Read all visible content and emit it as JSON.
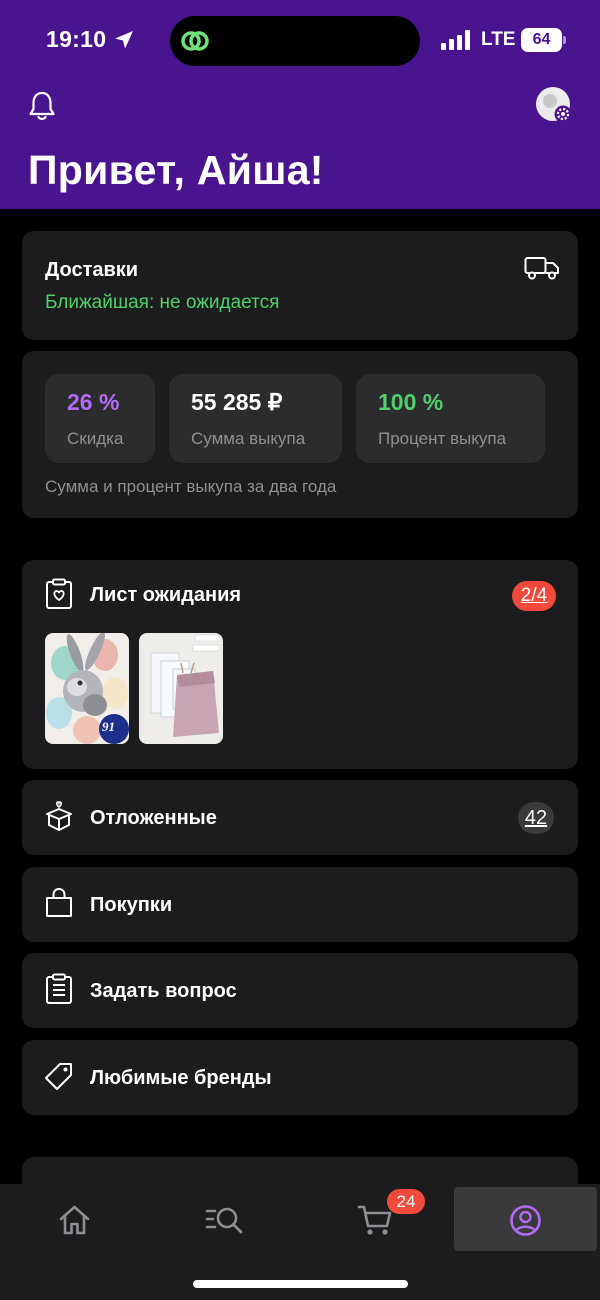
{
  "status_bar": {
    "time": "19:10",
    "network": "LTE",
    "battery": "64"
  },
  "header": {
    "greeting": "Привет, Айша!"
  },
  "delivery": {
    "title": "Доставки",
    "subtitle": "Ближайшая: не ожидается"
  },
  "stats": {
    "items": [
      {
        "value": "26 %",
        "label": "Скидка",
        "color": "#b36bf5"
      },
      {
        "value": "55 285 ₽",
        "label": "Сумма выкупа",
        "color": "#ffffff"
      },
      {
        "value": "100 %",
        "label": "Процент выкупа",
        "color": "#4fd06a"
      }
    ],
    "note": "Сумма и процент выкупа за два года"
  },
  "waitlist": {
    "title": "Лист ожидания",
    "badge": "2/4",
    "thumb_price": "91"
  },
  "menu": {
    "deferred": {
      "label": "Отложенные",
      "count": "42"
    },
    "purchases": {
      "label": "Покупки"
    },
    "ask": {
      "label": "Задать вопрос"
    },
    "brands": {
      "label": "Любимые бренды"
    }
  },
  "tabbar": {
    "cart_count": "24"
  },
  "colors": {
    "brand": "#4b148f",
    "accent": "#b36bf5",
    "success": "#4fd06a",
    "badge": "#ef4a3c",
    "card": "#1c1c1e"
  }
}
